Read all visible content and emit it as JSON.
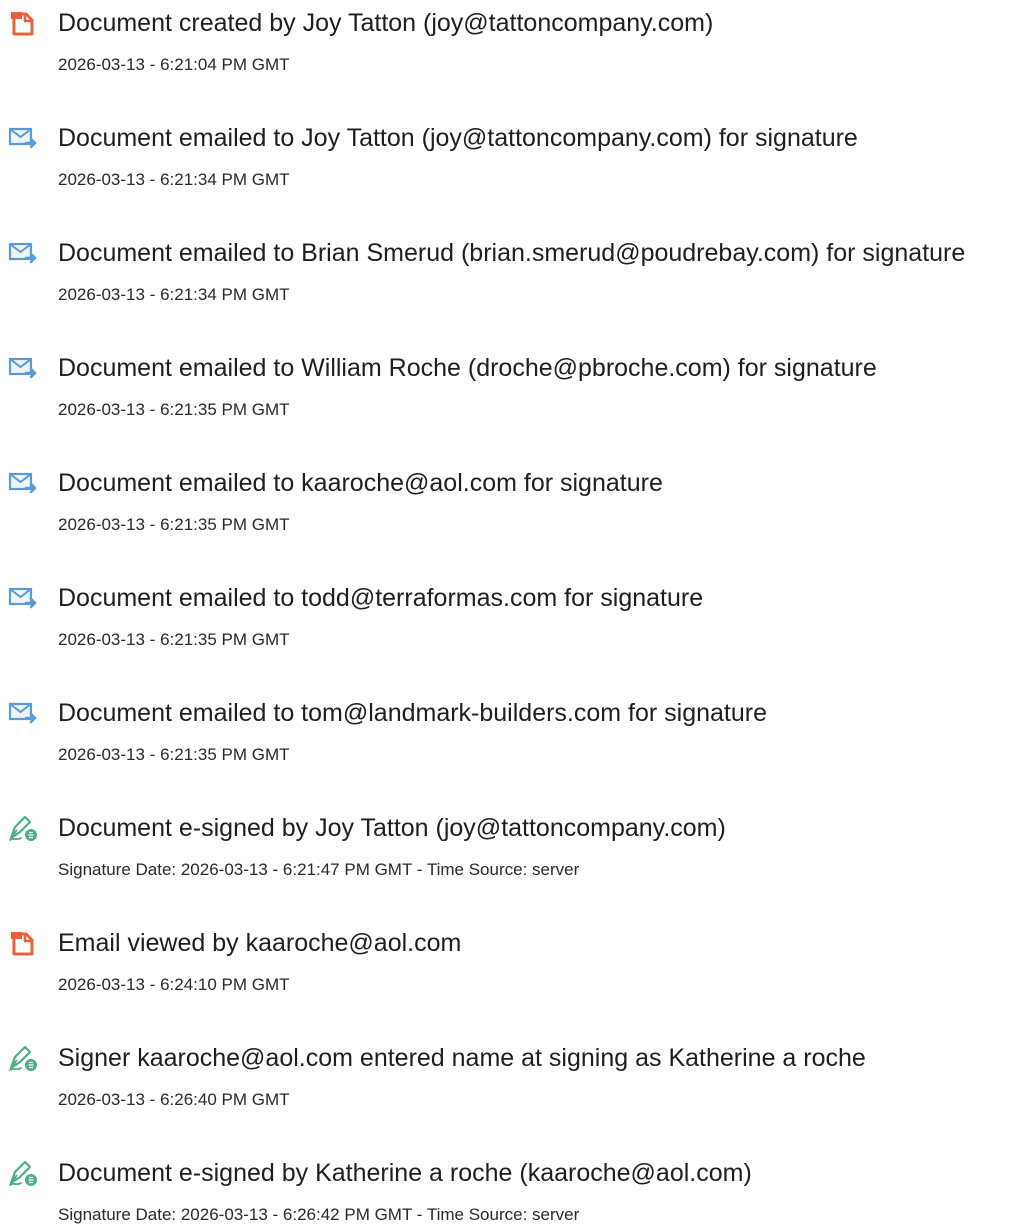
{
  "colors": {
    "doc_icon": "#e8613c",
    "mail_icon": "#5b9bd5",
    "sign_icon": "#4caf82"
  },
  "events": [
    {
      "icon": "document-icon",
      "title": "Document created by Joy Tatton (joy@tattoncompany.com)",
      "time": "2026-03-13 - 6:21:04 PM GMT"
    },
    {
      "icon": "email-icon",
      "title": "Document emailed to Joy Tatton (joy@tattoncompany.com) for signature",
      "time": "2026-03-13 - 6:21:34 PM GMT"
    },
    {
      "icon": "email-icon",
      "title": "Document emailed to Brian Smerud (brian.smerud@poudrebay.com) for signature",
      "time": "2026-03-13 - 6:21:34 PM GMT"
    },
    {
      "icon": "email-icon",
      "title": "Document emailed to William Roche (droche@pbroche.com) for signature",
      "time": "2026-03-13 - 6:21:35 PM GMT"
    },
    {
      "icon": "email-icon",
      "title": "Document emailed to kaaroche@aol.com for signature",
      "time": "2026-03-13 - 6:21:35 PM GMT"
    },
    {
      "icon": "email-icon",
      "title": "Document emailed to todd@terraformas.com for signature",
      "time": "2026-03-13 - 6:21:35 PM GMT"
    },
    {
      "icon": "email-icon",
      "title": "Document emailed to tom@landmark-builders.com for signature",
      "time": "2026-03-13 - 6:21:35 PM GMT"
    },
    {
      "icon": "esign-icon",
      "title": "Document e-signed by Joy Tatton (joy@tattoncompany.com)",
      "time": "Signature Date: 2026-03-13 - 6:21:47 PM GMT - Time Source: server"
    },
    {
      "icon": "document-icon",
      "title": "Email viewed by kaaroche@aol.com",
      "time": "2026-03-13 - 6:24:10 PM GMT"
    },
    {
      "icon": "esign-icon",
      "title": "Signer kaaroche@aol.com entered name at signing as Katherine a roche",
      "time": "2026-03-13 - 6:26:40 PM GMT"
    },
    {
      "icon": "esign-icon",
      "title": "Document e-signed by Katherine a roche (kaaroche@aol.com)",
      "time": "Signature Date: 2026-03-13 - 6:26:42 PM GMT - Time Source: server"
    }
  ]
}
